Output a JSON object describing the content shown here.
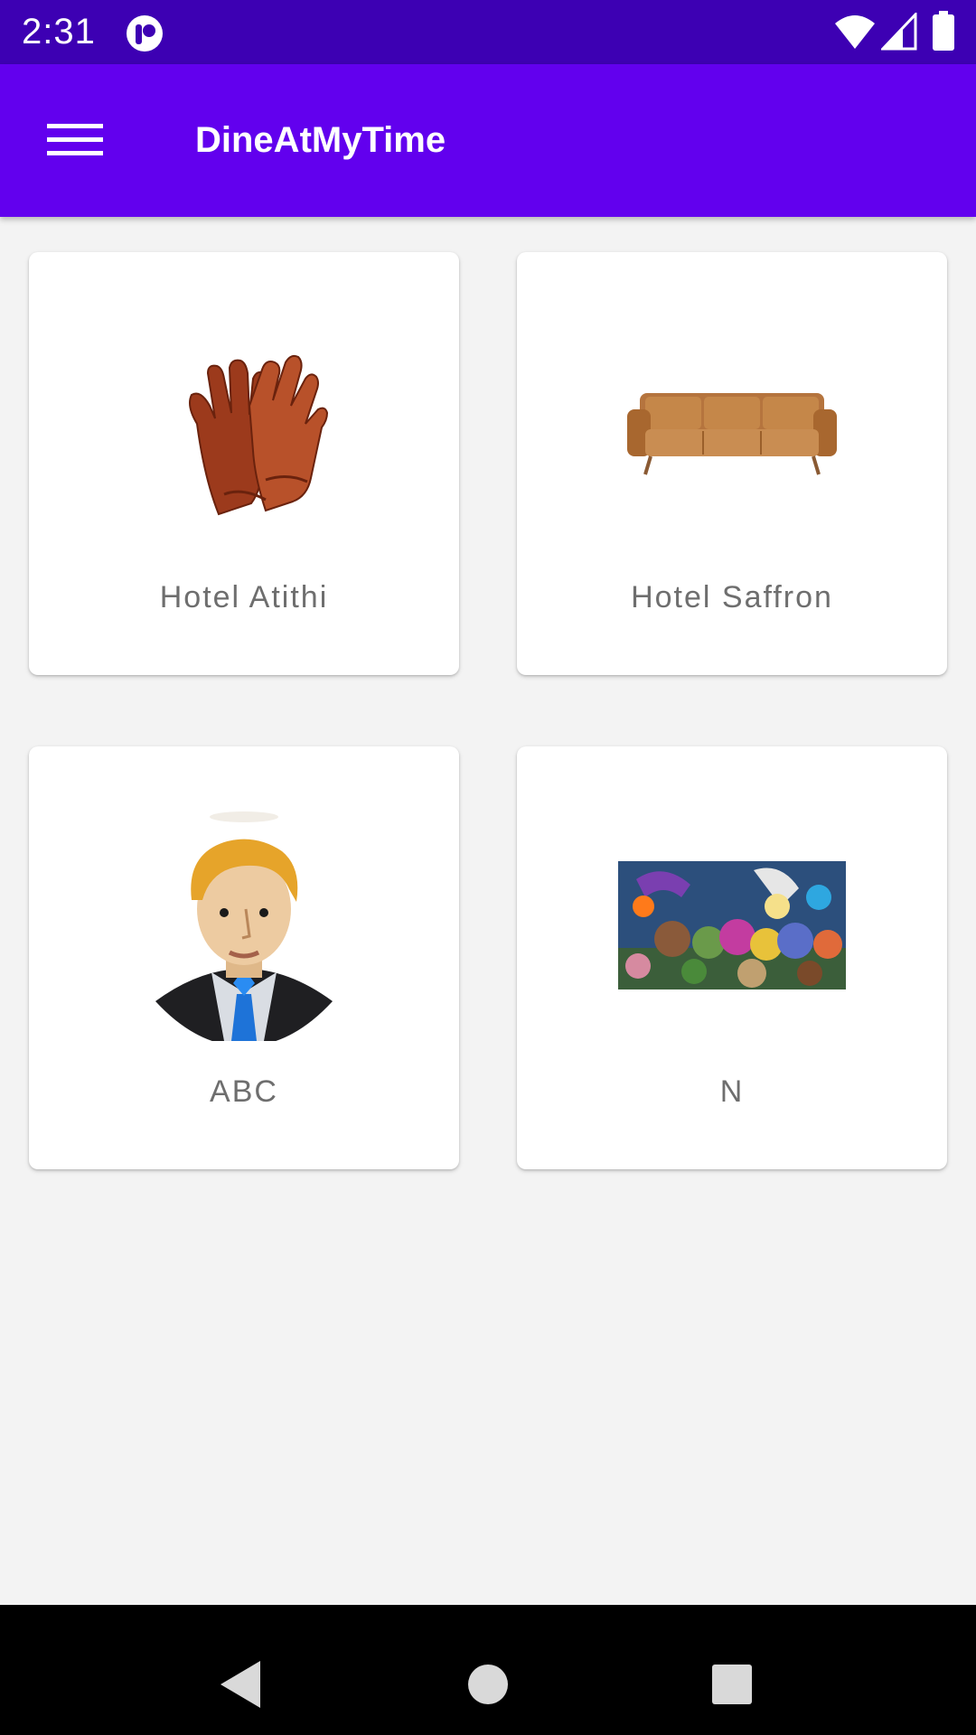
{
  "status_bar": {
    "time": "2:31",
    "icons": [
      "app-notification-icon",
      "wifi-icon",
      "cell-signal-icon",
      "battery-icon"
    ]
  },
  "app_bar": {
    "title": "DineAtMyTime",
    "menu_icon": "hamburger-menu-icon",
    "background": "#6200ee"
  },
  "hotels": [
    {
      "name": "Hotel Atithi",
      "image": "leather-gloves-image"
    },
    {
      "name": "Hotel Saffron",
      "image": "leather-sofa-image"
    },
    {
      "name": "ABC",
      "image": "businessman-avatar-image"
    },
    {
      "name": "N",
      "image": "game-characters-banner-image"
    }
  ],
  "nav_bar": {
    "buttons": [
      "back-icon",
      "home-icon",
      "recents-icon"
    ]
  },
  "colors": {
    "status_bar": "#3d00b3",
    "accent": "#6200ee",
    "page_background": "#f3f3f3",
    "card_label": "#6e6e6e"
  }
}
